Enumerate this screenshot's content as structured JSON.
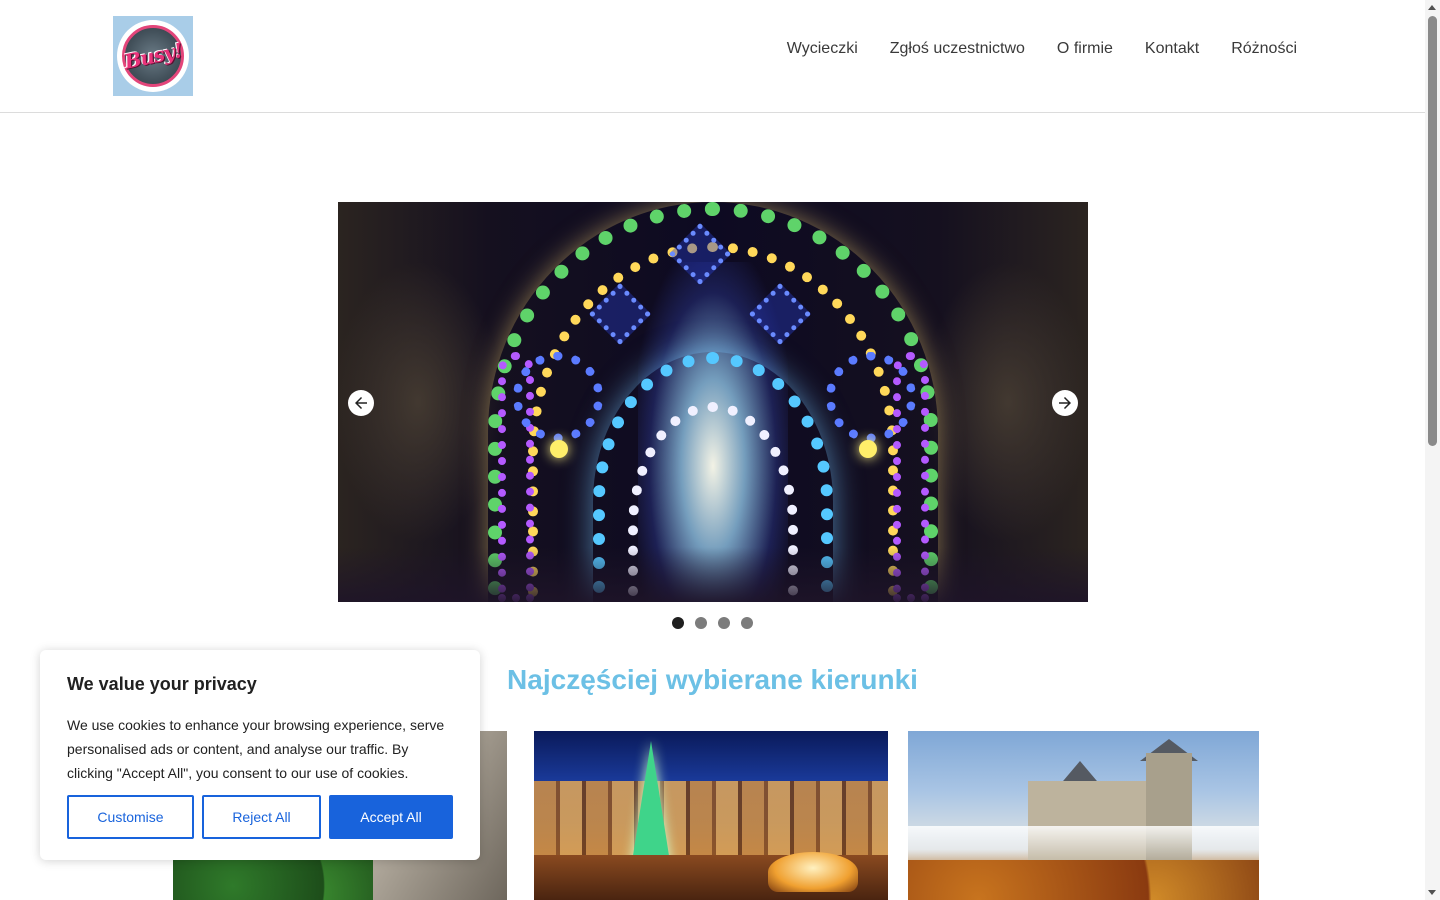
{
  "header": {
    "logo_text": "Busy!",
    "nav": [
      {
        "label": "Wycieczki"
      },
      {
        "label": "Zgłoś uczestnictwo"
      },
      {
        "label": "O firmie"
      },
      {
        "label": "Kontakt"
      },
      {
        "label": "Różności"
      }
    ]
  },
  "slider": {
    "icons": {
      "prev": "arrow-left-icon",
      "next": "arrow-right-icon"
    },
    "dot_count": 4,
    "active_dot": 1
  },
  "section": {
    "title": "Najczęściej wybierane kierunki"
  },
  "cookie": {
    "title": "We value your privacy",
    "text": "We use cookies to enhance your browsing experience, serve personalised ads or content, and analyse our traffic. By clicking \"Accept All\", you consent to our use of cookies.",
    "customise_label": "Customise",
    "reject_label": "Reject All",
    "accept_label": "Accept All"
  },
  "colors": {
    "accent": "#1863dc",
    "section_title": "#6cc0e5",
    "nav_text": "#3a3a3a"
  }
}
